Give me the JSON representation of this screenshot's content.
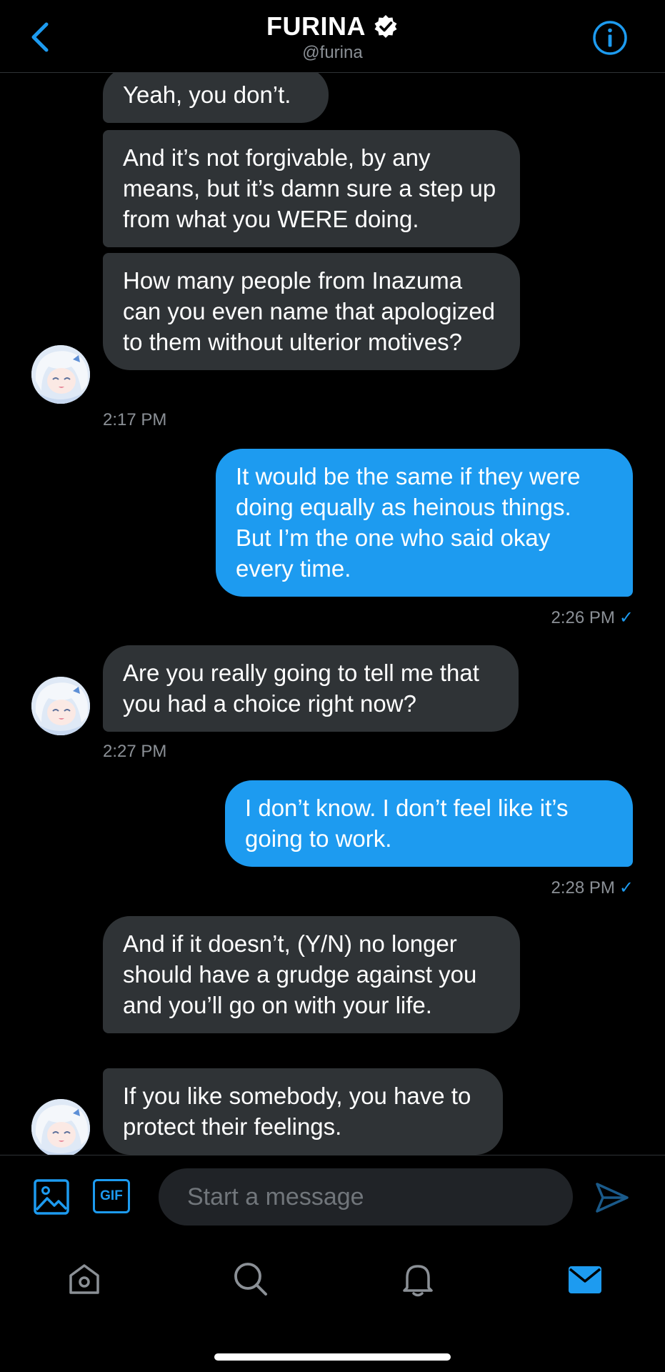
{
  "header": {
    "title": "FURINA",
    "handle": "@furina"
  },
  "messages": [
    {
      "side": "in",
      "text": "Yeah, you don’t."
    },
    {
      "side": "in",
      "text": "And it’s not forgivable, by any means, but it’s damn sure a step up from what you WERE doing."
    },
    {
      "side": "in",
      "text": "How many people from Inazuma can you even name that apologized to them without ulterior motives?"
    },
    {
      "side": "out",
      "text": "It would be the same if they were doing equally as heinous things. But I’m the one who said okay every time."
    },
    {
      "side": "in",
      "text": "Are you really going to tell me that you had a choice right now?"
    },
    {
      "side": "out",
      "text": "I don’t know. I don’t feel like it’s going to work."
    },
    {
      "side": "in",
      "text": "And if it doesn’t, (Y/N) no longer should have a grudge against you and you’ll go on with your life."
    },
    {
      "side": "in",
      "text": "If you like somebody, you have to protect their feelings."
    }
  ],
  "timestamps": [
    "2:17 PM",
    "2:26 PM",
    "2:27 PM",
    "2:28 PM"
  ],
  "read_check": "✓",
  "composer": {
    "gif_label": "GIF",
    "placeholder": "Start a message"
  },
  "nav": {
    "items": [
      "home-icon",
      "search-icon",
      "bell-icon",
      "mail-icon"
    ],
    "active": "mail-icon"
  },
  "colors": {
    "accent": "#1d9bf0",
    "incoming_bubble": "#2f3336",
    "muted_text": "#8b9096"
  }
}
